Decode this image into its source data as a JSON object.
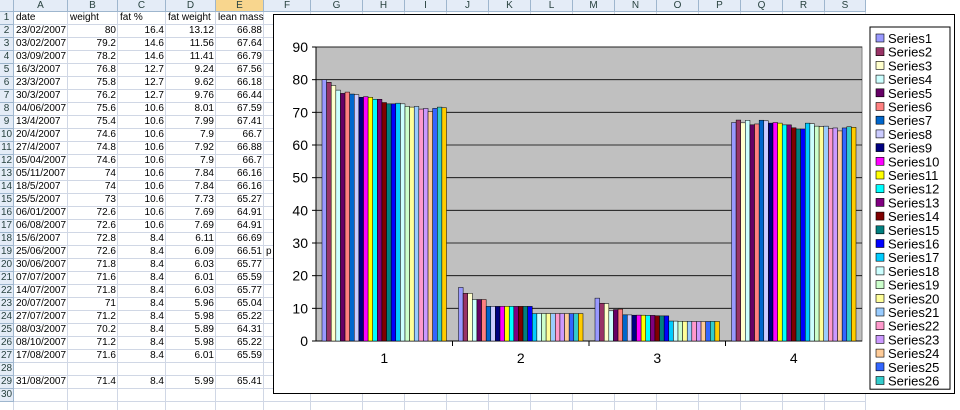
{
  "columns": [
    "A",
    "B",
    "C",
    "D",
    "E",
    "F",
    "G",
    "H",
    "I",
    "J",
    "K",
    "L",
    "M",
    "N",
    "O",
    "P",
    "Q",
    "R",
    "S"
  ],
  "selected_column": "E",
  "rows": [
    {
      "n": "1",
      "cells": [
        "date",
        "weight",
        "fat %",
        "fat weight",
        "lean mass"
      ]
    },
    {
      "n": "2",
      "cells": [
        "23/02/2007",
        "80",
        "16.4",
        "13.12",
        "66.88"
      ]
    },
    {
      "n": "3",
      "cells": [
        "03/02/2007",
        "79.2",
        "14.6",
        "11.56",
        "67.64"
      ]
    },
    {
      "n": "4",
      "cells": [
        "03/09/2007",
        "78.2",
        "14.6",
        "11.41",
        "66.79"
      ]
    },
    {
      "n": "5",
      "cells": [
        "16/3/2007",
        "76.8",
        "12.7",
        "9.24",
        "67.56"
      ]
    },
    {
      "n": "6",
      "cells": [
        "23/3/2007",
        "75.8",
        "12.7",
        "9.62",
        "66.18"
      ]
    },
    {
      "n": "7",
      "cells": [
        "30/3/2007",
        "76.2",
        "12.7",
        "9.76",
        "66.44"
      ]
    },
    {
      "n": "8",
      "cells": [
        "04/06/2007",
        "75.6",
        "10.6",
        "8.01",
        "67.59"
      ]
    },
    {
      "n": "9",
      "cells": [
        "13/4/2007",
        "75.4",
        "10.6",
        "7.99",
        "67.41"
      ]
    },
    {
      "n": "10",
      "cells": [
        "20/4/2007",
        "74.6",
        "10.6",
        "7.9",
        "66.7"
      ]
    },
    {
      "n": "11",
      "cells": [
        "27/4/2007",
        "74.8",
        "10.6",
        "7.92",
        "66.88"
      ]
    },
    {
      "n": "12",
      "cells": [
        "05/04/2007",
        "74.6",
        "10.6",
        "7.9",
        "66.7"
      ]
    },
    {
      "n": "13",
      "cells": [
        "05/11/2007",
        "74",
        "10.6",
        "7.84",
        "66.16"
      ]
    },
    {
      "n": "14",
      "cells": [
        "18/5/2007",
        "74",
        "10.6",
        "7.84",
        "66.16"
      ]
    },
    {
      "n": "15",
      "cells": [
        "25/5/2007",
        "73",
        "10.6",
        "7.73",
        "65.27"
      ]
    },
    {
      "n": "16",
      "cells": [
        "06/01/2007",
        "72.6",
        "10.6",
        "7.69",
        "64.91"
      ]
    },
    {
      "n": "17",
      "cells": [
        "06/08/2007",
        "72.6",
        "10.6",
        "7.69",
        "64.91"
      ]
    },
    {
      "n": "18",
      "cells": [
        "15/6/2007",
        "72.8",
        "8.4",
        "6.11",
        "66.69"
      ]
    },
    {
      "n": "19",
      "cells": [
        "25/06/2007",
        "72.6",
        "8.4",
        "6.09",
        "66.51"
      ]
    },
    {
      "n": "20",
      "cells": [
        "30/06/2007",
        "71.8",
        "8.4",
        "6.03",
        "65.77"
      ]
    },
    {
      "n": "21",
      "cells": [
        "07/07/2007",
        "71.6",
        "8.4",
        "6.01",
        "65.59"
      ]
    },
    {
      "n": "22",
      "cells": [
        "14/07/2007",
        "71.8",
        "8.4",
        "6.03",
        "65.77"
      ]
    },
    {
      "n": "23",
      "cells": [
        "20/07/2007",
        "71",
        "8.4",
        "5.96",
        "65.04"
      ]
    },
    {
      "n": "24",
      "cells": [
        "27/07/2007",
        "71.2",
        "8.4",
        "5.98",
        "65.22"
      ]
    },
    {
      "n": "25",
      "cells": [
        "08/03/2007",
        "70.2",
        "8.4",
        "5.89",
        "64.31"
      ]
    },
    {
      "n": "26",
      "cells": [
        "08/10/2007",
        "71.2",
        "8.4",
        "5.98",
        "65.22"
      ]
    },
    {
      "n": "27",
      "cells": [
        "17/08/2007",
        "71.6",
        "8.4",
        "6.01",
        "65.59"
      ]
    },
    {
      "n": "28",
      "cells": [
        "",
        "",
        "",
        "",
        ""
      ]
    },
    {
      "n": "29",
      "cells": [
        "31/08/2007",
        "71.4",
        "8.4",
        "5.99",
        "65.41"
      ]
    },
    {
      "n": "30",
      "cells": [
        "",
        "",
        "",
        "",
        ""
      ]
    }
  ],
  "stray_text": "p",
  "chart_data": {
    "type": "bar",
    "categories": [
      "1",
      "2",
      "3",
      "4"
    ],
    "ylim": [
      0,
      90
    ],
    "yticks": [
      "0",
      "10",
      "20",
      "30",
      "40",
      "50",
      "60",
      "70",
      "80",
      "90"
    ],
    "grid": true,
    "legend_position": "right",
    "plot_background": "#c0c0c0",
    "series": [
      {
        "name": "Series1",
        "color": "#9999ff",
        "values": [
          80,
          16.4,
          13.12,
          66.88
        ]
      },
      {
        "name": "Series2",
        "color": "#993366",
        "values": [
          79.2,
          14.6,
          11.56,
          67.64
        ]
      },
      {
        "name": "Series3",
        "color": "#ffffcc",
        "values": [
          78.2,
          14.6,
          11.41,
          66.79
        ]
      },
      {
        "name": "Series4",
        "color": "#ccffff",
        "values": [
          76.8,
          12.7,
          9.24,
          67.56
        ]
      },
      {
        "name": "Series5",
        "color": "#660066",
        "values": [
          75.8,
          12.7,
          9.62,
          66.18
        ]
      },
      {
        "name": "Series6",
        "color": "#ff8080",
        "values": [
          76.2,
          12.7,
          9.76,
          66.44
        ]
      },
      {
        "name": "Series7",
        "color": "#0066cc",
        "values": [
          75.6,
          10.6,
          8.01,
          67.59
        ]
      },
      {
        "name": "Series8",
        "color": "#ccccff",
        "values": [
          75.4,
          10.6,
          7.99,
          67.41
        ]
      },
      {
        "name": "Series9",
        "color": "#000080",
        "values": [
          74.6,
          10.6,
          7.9,
          66.7
        ]
      },
      {
        "name": "Series10",
        "color": "#ff00ff",
        "values": [
          74.8,
          10.6,
          7.92,
          66.88
        ]
      },
      {
        "name": "Series11",
        "color": "#ffff00",
        "values": [
          74.6,
          10.6,
          7.9,
          66.7
        ]
      },
      {
        "name": "Series12",
        "color": "#00ffff",
        "values": [
          74,
          10.6,
          7.84,
          66.16
        ]
      },
      {
        "name": "Series13",
        "color": "#800080",
        "values": [
          74,
          10.6,
          7.84,
          66.16
        ]
      },
      {
        "name": "Series14",
        "color": "#800000",
        "values": [
          73,
          10.6,
          7.73,
          65.27
        ]
      },
      {
        "name": "Series15",
        "color": "#008080",
        "values": [
          72.6,
          10.6,
          7.69,
          64.91
        ]
      },
      {
        "name": "Series16",
        "color": "#0000ff",
        "values": [
          72.6,
          10.6,
          7.69,
          64.91
        ]
      },
      {
        "name": "Series17",
        "color": "#00ccff",
        "values": [
          72.8,
          8.4,
          6.11,
          66.69
        ]
      },
      {
        "name": "Series18",
        "color": "#ccffff",
        "values": [
          72.6,
          8.4,
          6.09,
          66.51
        ]
      },
      {
        "name": "Series19",
        "color": "#ccffcc",
        "values": [
          71.8,
          8.4,
          6.03,
          65.77
        ]
      },
      {
        "name": "Series20",
        "color": "#ffff99",
        "values": [
          71.6,
          8.4,
          6.01,
          65.59
        ]
      },
      {
        "name": "Series21",
        "color": "#99ccff",
        "values": [
          71.8,
          8.4,
          6.03,
          65.77
        ]
      },
      {
        "name": "Series22",
        "color": "#ff99cc",
        "values": [
          71,
          8.4,
          5.96,
          65.04
        ]
      },
      {
        "name": "Series23",
        "color": "#cc99ff",
        "values": [
          71.2,
          8.4,
          5.98,
          65.22
        ]
      },
      {
        "name": "Series24",
        "color": "#ffcc99",
        "values": [
          70.2,
          8.4,
          5.89,
          64.31
        ]
      },
      {
        "name": "Series25",
        "color": "#3366ff",
        "values": [
          71.2,
          8.4,
          5.98,
          65.22
        ]
      },
      {
        "name": "Series26",
        "color": "#33cccc",
        "values": [
          71.6,
          8.4,
          6.01,
          65.59
        ]
      },
      {
        "name": "",
        "color": "#ffcc00",
        "values": [
          71.4,
          8.4,
          5.99,
          65.41
        ]
      }
    ]
  }
}
